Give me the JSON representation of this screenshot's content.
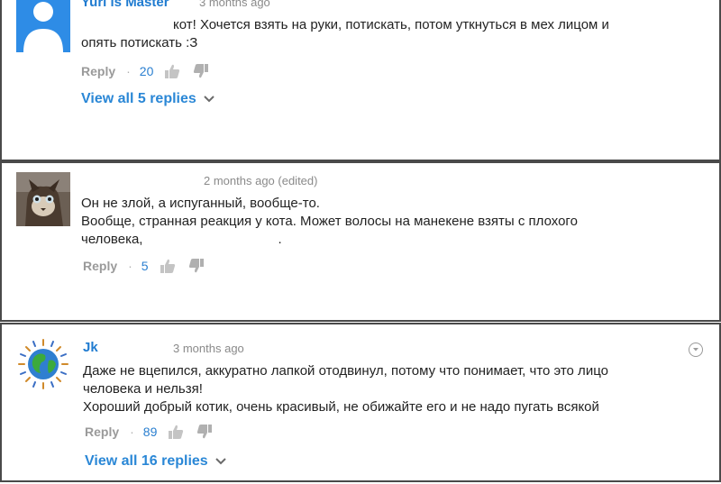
{
  "comments": [
    {
      "author": "Yuri is Master",
      "time": "3 months ago",
      "lines": [
        "кот! Хочется взять на руки, потискать, потом уткнуться в мех лицом и",
        "опять потискать :З"
      ],
      "reply_label": "Reply",
      "likes": "20",
      "avatar_icon": "default-user-icon",
      "view_replies": "View all 5 replies"
    },
    {
      "time": "2 months ago (edited)",
      "lines": [
        "Он не злой, а испуганный, вообще-то.",
        "Вообще, странная реакция у кота. Может волосы на манекене взяты с плохого",
        "человека,                                    ."
      ],
      "reply_label": "Reply",
      "likes": "5",
      "avatar_icon": "cat-photo-icon"
    },
    {
      "author": "Jk",
      "time": "3 months ago",
      "lines": [
        "Даже не вцепился, аккуратно лапкой отодвинул, потому что понимает, что это лицо",
        "человека и нельзя!",
        "Хороший добрый котик, очень красивый, не обижайте его и не надо пугать всякой"
      ],
      "reply_label": "Reply",
      "likes": "89",
      "avatar_icon": "globe-icon",
      "view_replies": "View all 16 replies"
    }
  ],
  "colors": {
    "link": "#2a87d6",
    "meta": "#8a8a8a",
    "border": "#4a4a4a"
  }
}
